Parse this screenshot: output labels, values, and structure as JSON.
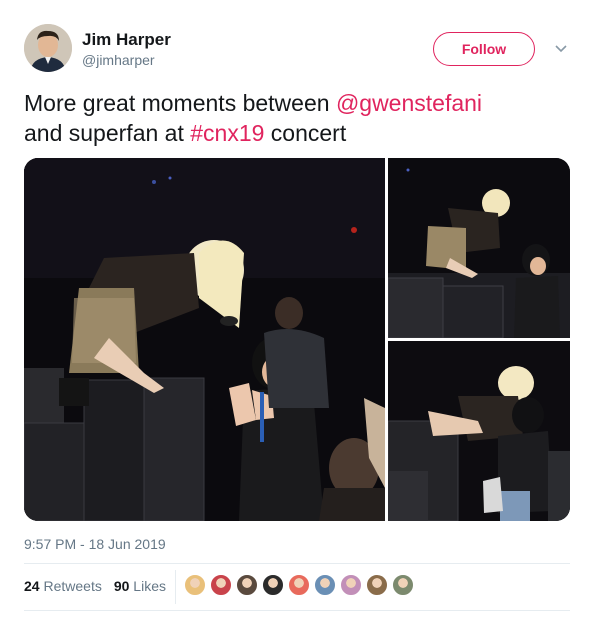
{
  "author": {
    "name": "Jim Harper",
    "handle": "@jimharper",
    "avatar_icon": "profile-photo"
  },
  "follow_label": "Follow",
  "menu_icon": "chevron-down-icon",
  "tweet": {
    "text_1": "More great moments between ",
    "mention": "@gwenstefani",
    "text_2": "and superfan at ",
    "hashtag": "#cnx19",
    "text_3": " concert"
  },
  "media": {
    "photo_count": 3
  },
  "timestamp": "9:57 PM - 18 Jun 2019",
  "stats": {
    "retweets_count": "24",
    "retweets_label": "Retweets",
    "likes_count": "90",
    "likes_label": "Likes"
  },
  "likers": {
    "colors": [
      "#e9c07a",
      "#c9434b",
      "#5a4a3e",
      "#2b2b2b",
      "#e86a5c",
      "#6a8fb5",
      "#c28fb8",
      "#8a6c4a",
      "#7c8a6e"
    ]
  },
  "colors": {
    "accent": "#e0245e",
    "secondary_text": "#657786",
    "divider": "#e6ecf0"
  }
}
